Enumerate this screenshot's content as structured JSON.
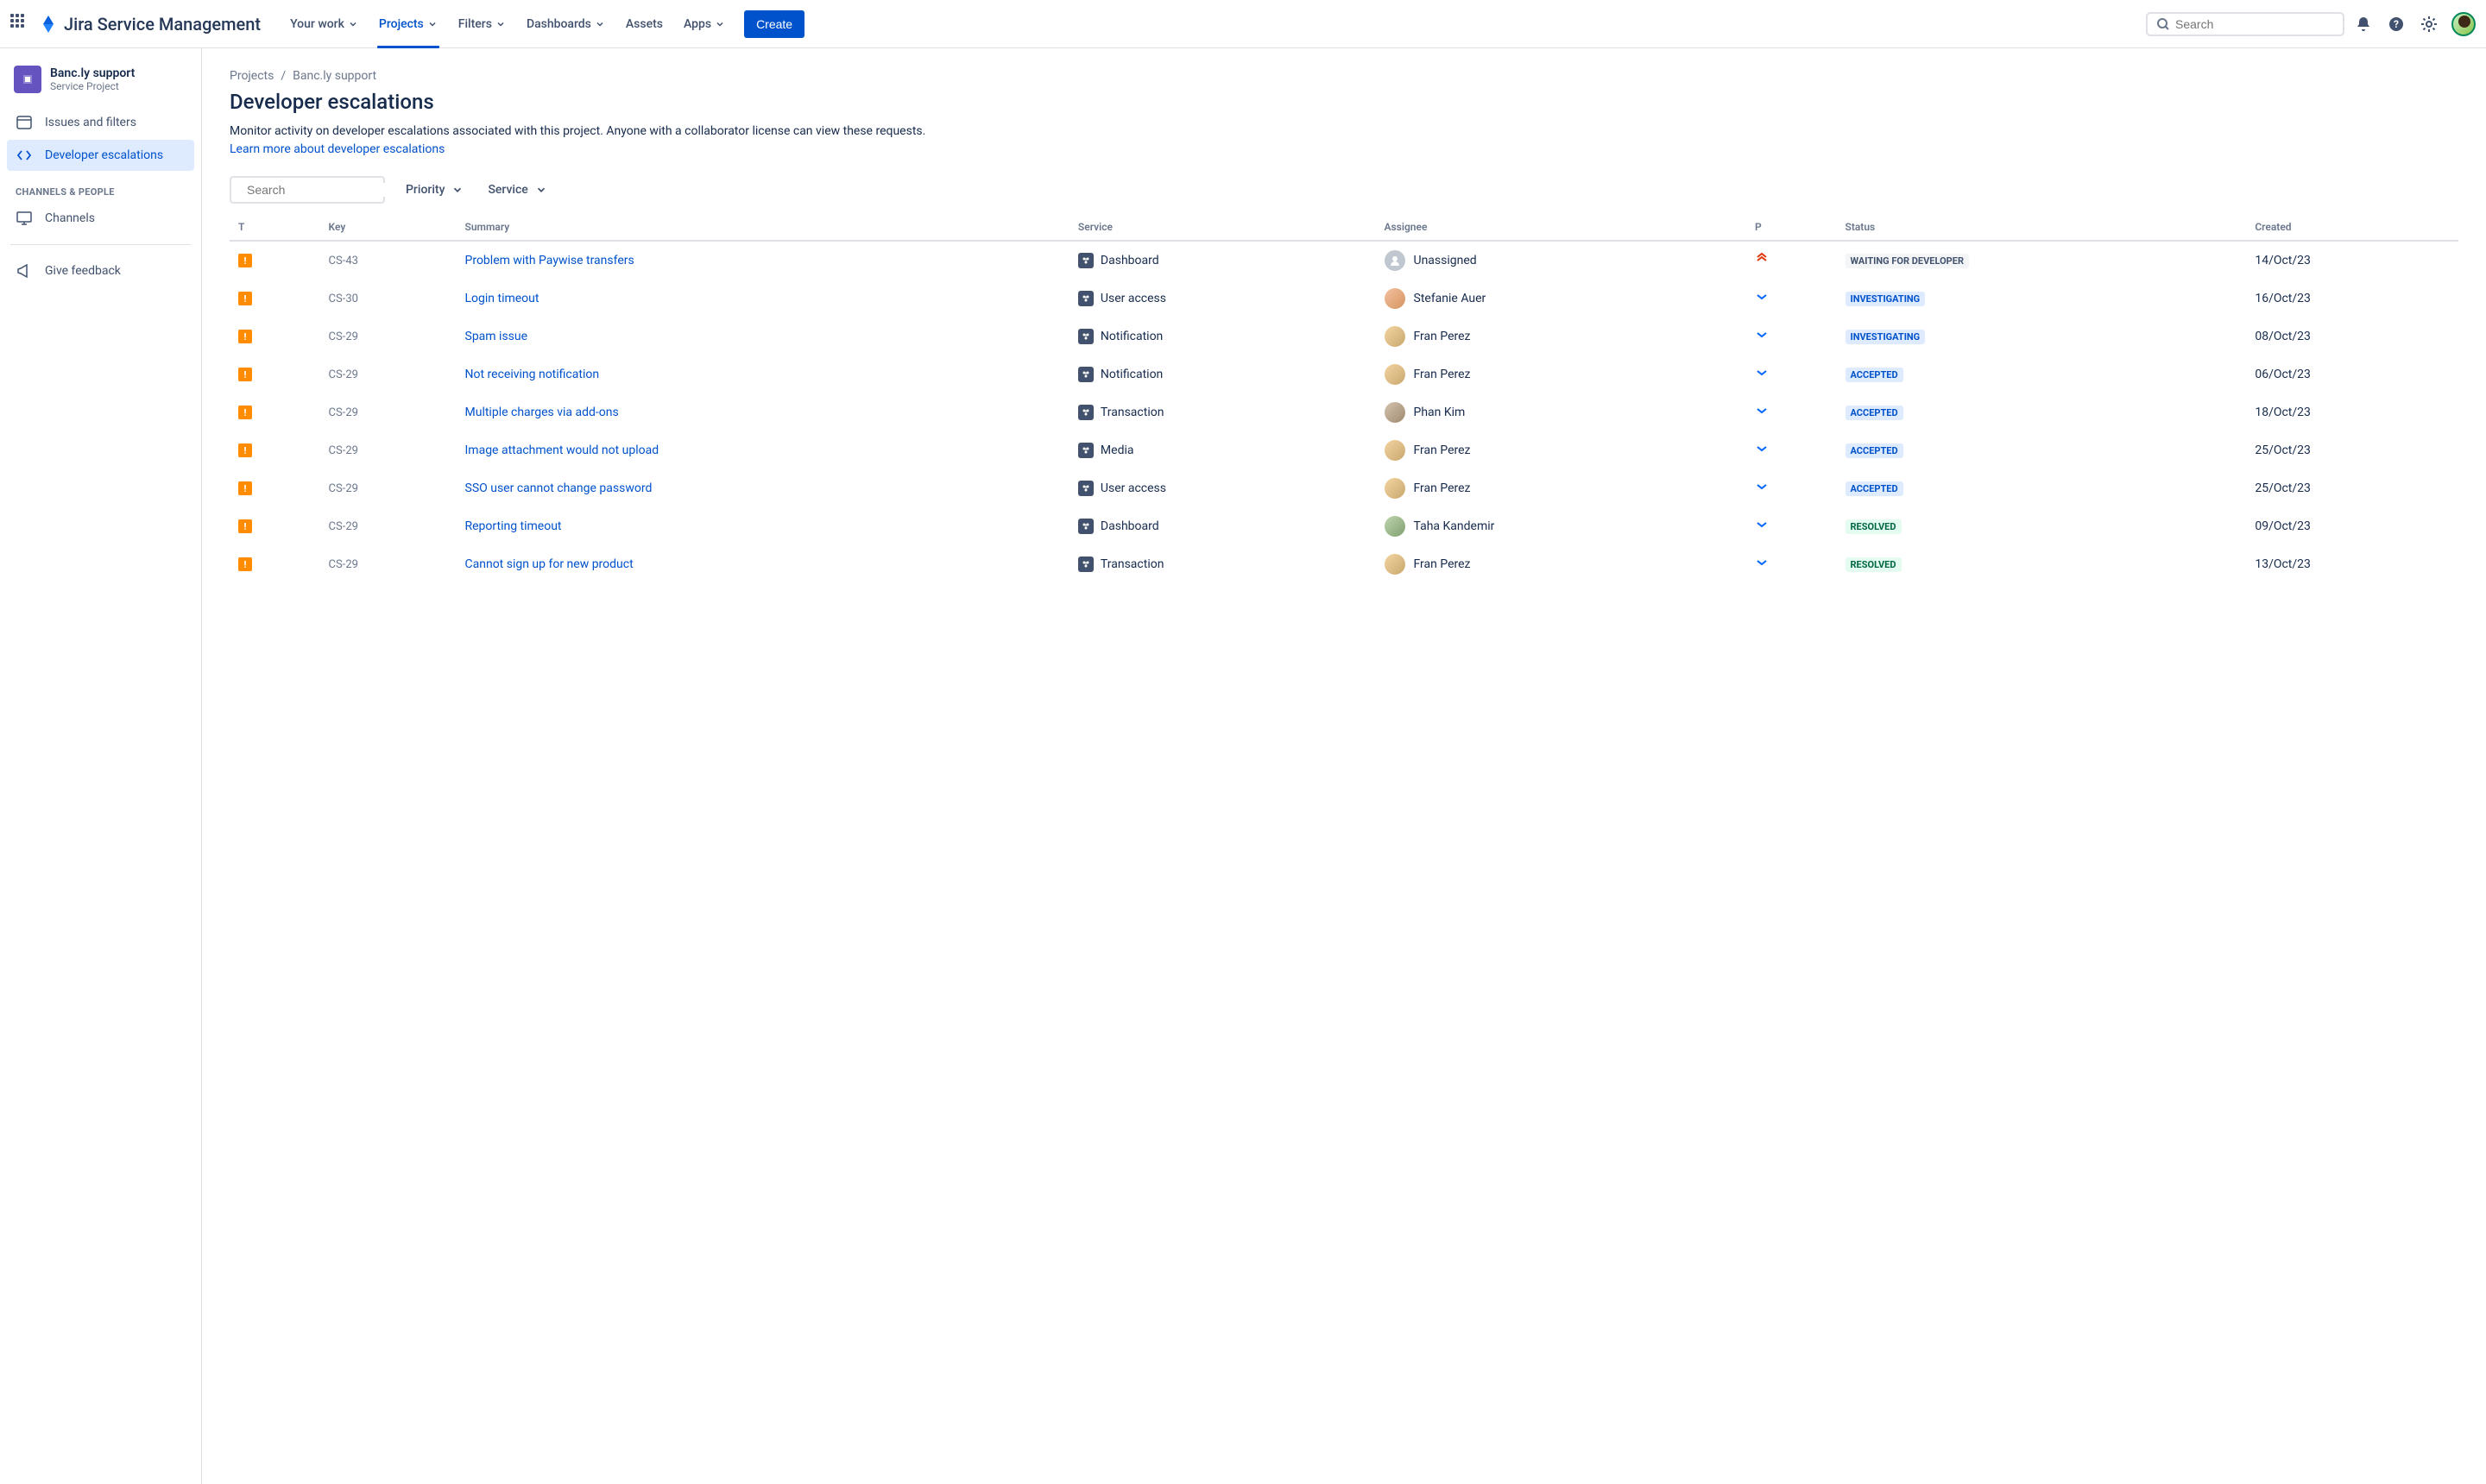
{
  "app": {
    "name": "Jira Service Management"
  },
  "nav": {
    "your_work": "Your work",
    "projects": "Projects",
    "filters": "Filters",
    "dashboards": "Dashboards",
    "assets": "Assets",
    "apps": "Apps",
    "create": "Create"
  },
  "search": {
    "placeholder": "Search"
  },
  "sidebar": {
    "project_name": "Banc.ly support",
    "project_type": "Service Project",
    "issues": "Issues and filters",
    "dev_escalations": "Developer escalations",
    "section_channels": "CHANNELS & PEOPLE",
    "channels": "Channels",
    "feedback": "Give feedback"
  },
  "breadcrumb": {
    "projects": "Projects",
    "current": "Banc.ly support"
  },
  "page": {
    "title": "Developer escalations",
    "description": "Monitor activity on developer escalations associated with this project. Anyone with a collaborator license can view these requests.",
    "learn_more": "Learn more about developer escalations"
  },
  "filters": {
    "search_placeholder": "Search",
    "priority": "Priority",
    "service": "Service"
  },
  "table": {
    "headers": {
      "type": "T",
      "key": "Key",
      "summary": "Summary",
      "service": "Service",
      "assignee": "Assignee",
      "priority": "P",
      "status": "Status",
      "created": "Created"
    },
    "rows": [
      {
        "key": "CS-43",
        "summary": "Problem with Paywise transfers",
        "service": "Dashboard",
        "assignee": "Unassigned",
        "assignee_class": "unassigned",
        "priority": "highest",
        "status": "WAITING FOR DEVELOPER",
        "status_class": "status-waiting",
        "created": "14/Oct/23"
      },
      {
        "key": "CS-30",
        "summary": "Login timeout",
        "service": "User access",
        "assignee": "Stefanie Auer",
        "assignee_class": "a1",
        "priority": "low",
        "status": "INVESTIGATING",
        "status_class": "status-investigating",
        "created": "16/Oct/23"
      },
      {
        "key": "CS-29",
        "summary": "Spam issue",
        "service": "Notification",
        "assignee": "Fran Perez",
        "assignee_class": "a2",
        "priority": "low",
        "status": "INVESTIGATING",
        "status_class": "status-investigating",
        "created": "08/Oct/23"
      },
      {
        "key": "CS-29",
        "summary": "Not receiving notification",
        "service": "Notification",
        "assignee": "Fran Perez",
        "assignee_class": "a2",
        "priority": "low",
        "status": "ACCEPTED",
        "status_class": "status-accepted",
        "created": "06/Oct/23"
      },
      {
        "key": "CS-29",
        "summary": "Multiple charges via add-ons",
        "service": "Transaction",
        "assignee": "Phan Kim",
        "assignee_class": "a3",
        "priority": "low",
        "status": "ACCEPTED",
        "status_class": "status-accepted",
        "created": "18/Oct/23"
      },
      {
        "key": "CS-29",
        "summary": "Image attachment would not upload",
        "service": "Media",
        "assignee": "Fran Perez",
        "assignee_class": "a2",
        "priority": "low",
        "status": "ACCEPTED",
        "status_class": "status-accepted",
        "created": "25/Oct/23"
      },
      {
        "key": "CS-29",
        "summary": "SSO user cannot change password",
        "service": "User access",
        "assignee": "Fran Perez",
        "assignee_class": "a2",
        "priority": "low",
        "status": "ACCEPTED",
        "status_class": "status-accepted",
        "created": "25/Oct/23"
      },
      {
        "key": "CS-29",
        "summary": "Reporting timeout",
        "service": "Dashboard",
        "assignee": "Taha Kandemir",
        "assignee_class": "a4",
        "priority": "low",
        "status": "RESOLVED",
        "status_class": "status-resolved",
        "created": "09/Oct/23"
      },
      {
        "key": "CS-29",
        "summary": "Cannot sign up for new product",
        "service": "Transaction",
        "assignee": "Fran Perez",
        "assignee_class": "a2",
        "priority": "low",
        "status": "RESOLVED",
        "status_class": "status-resolved",
        "created": "13/Oct/23"
      }
    ]
  }
}
